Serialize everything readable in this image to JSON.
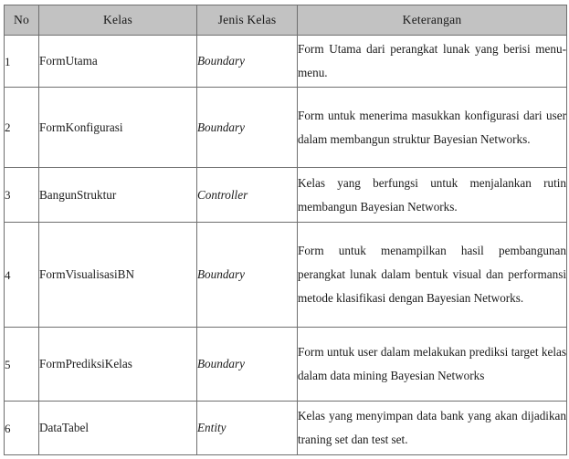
{
  "table": {
    "headers": [
      {
        "key": "no",
        "label": "No"
      },
      {
        "key": "kelas",
        "label": "Kelas"
      },
      {
        "key": "jenis_kelas",
        "label": "Jenis Kelas"
      },
      {
        "key": "keterangan",
        "label": "Keterangan"
      }
    ],
    "header_background": "#c2c2c2",
    "border_color": "#6f6f6f",
    "rows": [
      {
        "no": "1",
        "kelas": "FormUtama",
        "jenis_kelas": "Boundary",
        "keterangan": "Form Utama dari perangkat lunak yang berisi menu-menu."
      },
      {
        "no": "2",
        "kelas": "FormKonfigurasi",
        "jenis_kelas": "Boundary",
        "keterangan": "Form untuk menerima masukkan konfigurasi dari user dalam membangun struktur Bayesian Networks."
      },
      {
        "no": "3",
        "kelas": "BangunStruktur",
        "jenis_kelas": "Controller",
        "keterangan": "Kelas yang berfungsi untuk menjalankan rutin membangun Bayesian Networks."
      },
      {
        "no": "4",
        "kelas": "FormVisualisasiBN",
        "jenis_kelas": "Boundary",
        "keterangan": "Form untuk menampilkan hasil pembangunan perangkat lunak dalam bentuk visual dan performansi metode klasifikasi dengan Bayesian Networks."
      },
      {
        "no": "5",
        "kelas": "FormPrediksiKelas",
        "jenis_kelas": "Boundary",
        "keterangan": "Form untuk user dalam melakukan prediksi target kelas dalam data mining Bayesian Networks"
      },
      {
        "no": "6",
        "kelas": "DataTabel",
        "jenis_kelas": "Entity",
        "keterangan": "Kelas yang menyimpan data bank yang akan dijadikan traning set dan test set."
      }
    ]
  }
}
